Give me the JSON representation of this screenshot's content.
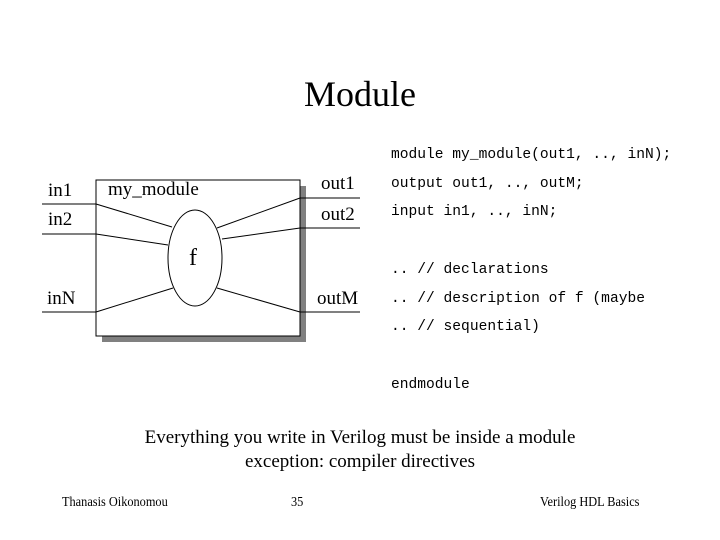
{
  "slide": {
    "title": "Module",
    "diagram": {
      "module_name": "my_module",
      "function_label": "f",
      "inputs": [
        "in1",
        "in2",
        "inN"
      ],
      "outputs": [
        "out1",
        "out2",
        "outM"
      ],
      "colors": {
        "stroke": "#000000",
        "shadow": "#808080",
        "fill": "#ffffff"
      }
    },
    "code": {
      "lines": [
        "module my_module(out1, .., inN);",
        "output out1, .., outM;",
        "input in1, .., inN;",
        ".. // declarations",
        ".. // description of f (maybe",
        ".. // sequential)",
        "endmodule"
      ]
    },
    "note": {
      "line1": "Everything you write in Verilog must be inside a module",
      "line2": "exception: compiler directives"
    },
    "footer": {
      "author": "Thanasis Oikonomou",
      "page_number": "35",
      "course": "Verilog HDL Basics"
    }
  }
}
